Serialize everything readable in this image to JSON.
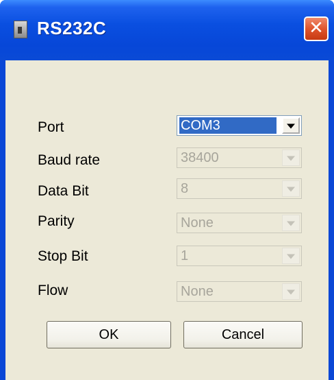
{
  "window": {
    "title": "RS232C",
    "close_label": "✕"
  },
  "fields": [
    {
      "label": "Port",
      "value": "COM3",
      "enabled": true,
      "selected": true
    },
    {
      "label": "Baud rate",
      "value": "38400",
      "enabled": false
    },
    {
      "label": "Data Bit",
      "value": "8",
      "enabled": false
    },
    {
      "label": "Parity",
      "value": "None",
      "enabled": false
    },
    {
      "label": "Stop Bit",
      "value": "1",
      "enabled": false
    },
    {
      "label": "Flow",
      "value": "None",
      "enabled": false
    }
  ],
  "buttons": {
    "ok_label": "OK",
    "cancel_label": "Cancel"
  },
  "colors": {
    "titlebar": "#0747d8",
    "client": "#ece9d8",
    "selection": "#316ac5",
    "close_button": "#e0552d",
    "disabled_text": "#a7a59b"
  }
}
